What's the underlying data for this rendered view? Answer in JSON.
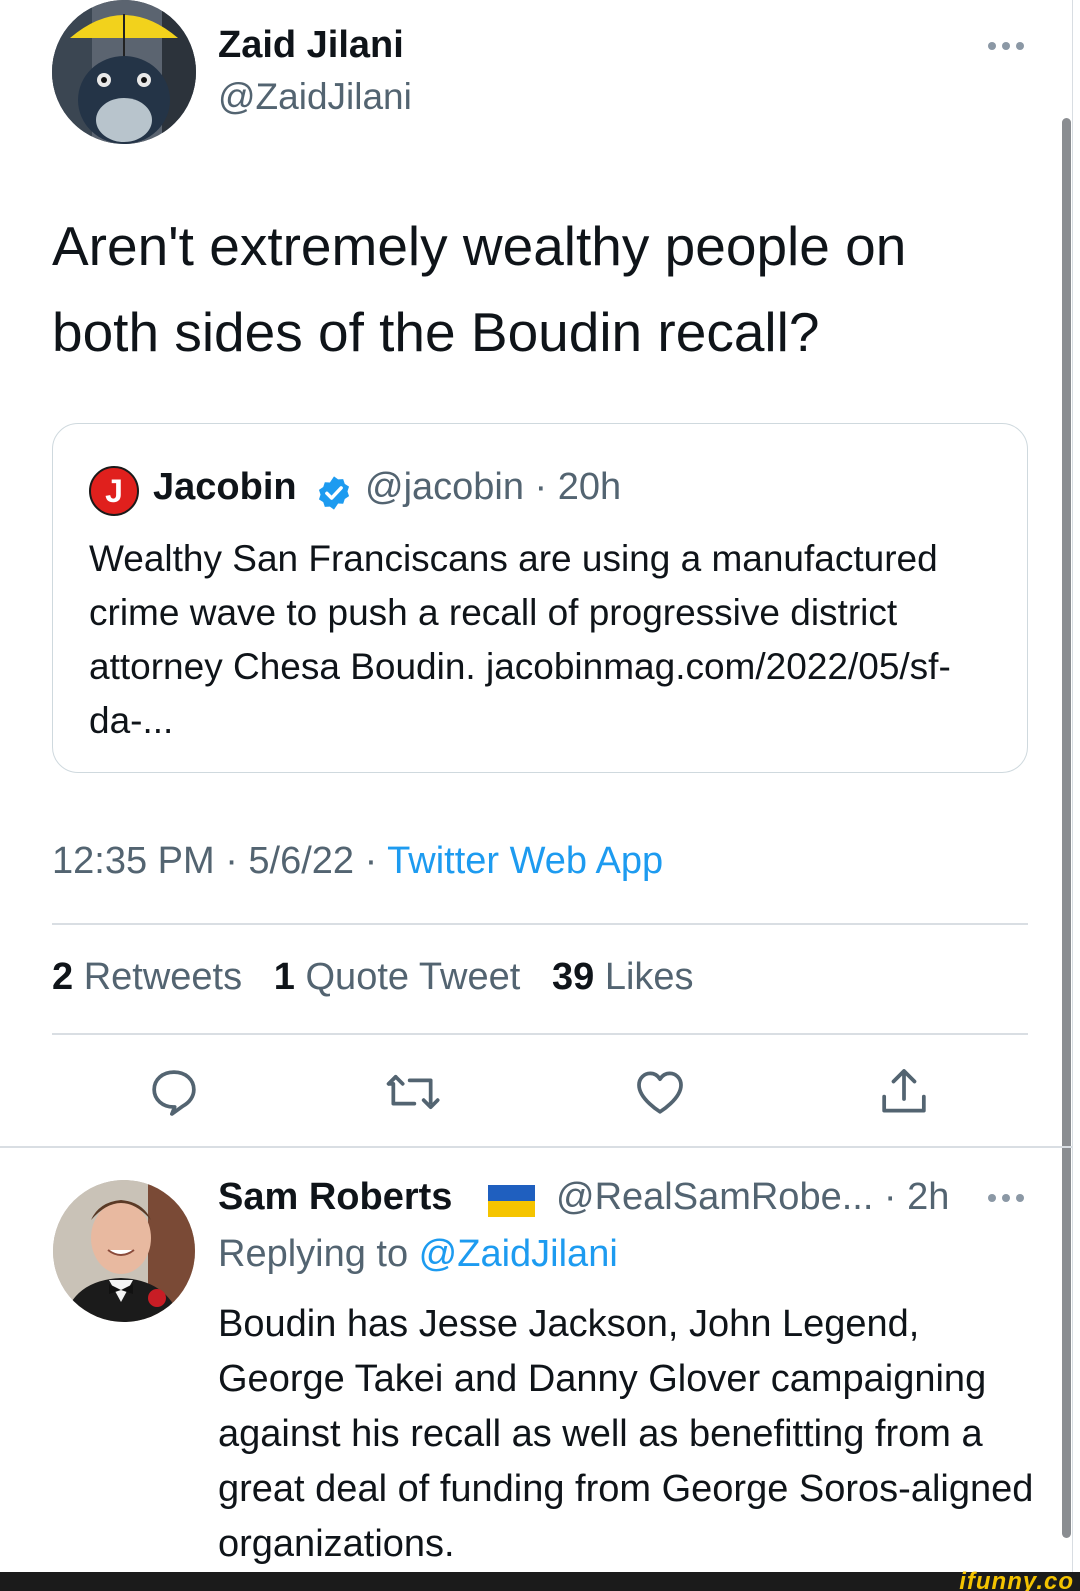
{
  "tweet": {
    "author_name": "Zaid Jilani",
    "author_handle": "@ZaidJilani",
    "text": "Aren't extremely wealthy people on both sides of the Boudin recall?",
    "timestamp": "12:35 PM · 5/6/22 · ",
    "source": "Twitter Web App"
  },
  "quote": {
    "logo_letter": "J",
    "name": "Jacobin",
    "handle_time": "@jacobin · 20h",
    "text": "Wealthy San Franciscans are using a manufactured crime wave to push a recall of progressive district attorney Chesa Boudin. jacobinmag.com/2022/05/sf-da-..."
  },
  "stats": {
    "retweets_count": "2",
    "retweets_label": "Retweets",
    "quotes_count": "1",
    "quotes_label": "Quote Tweet",
    "likes_count": "39",
    "likes_label": "Likes"
  },
  "reply": {
    "author_name": "Sam Roberts",
    "handle_time": "@RealSamRobe... · 2h",
    "replying_prefix": "Replying to ",
    "replying_to": "@ZaidJilani",
    "text": "Boudin has Jesse Jackson, John Legend, George Takei and Danny Glover campaigning against his recall as well as benefitting from a great deal of funding from George Soros-aligned organizations."
  },
  "watermark": "ifunny.co",
  "icons": [
    "more-icon",
    "verified-icon",
    "reply-icon",
    "retweet-icon",
    "like-icon",
    "share-icon",
    "ukraine-flag-icon"
  ],
  "colors": {
    "link": "#1d9bf0",
    "secondary": "#536471",
    "text": "#0f1419",
    "border": "#cfd9de"
  }
}
